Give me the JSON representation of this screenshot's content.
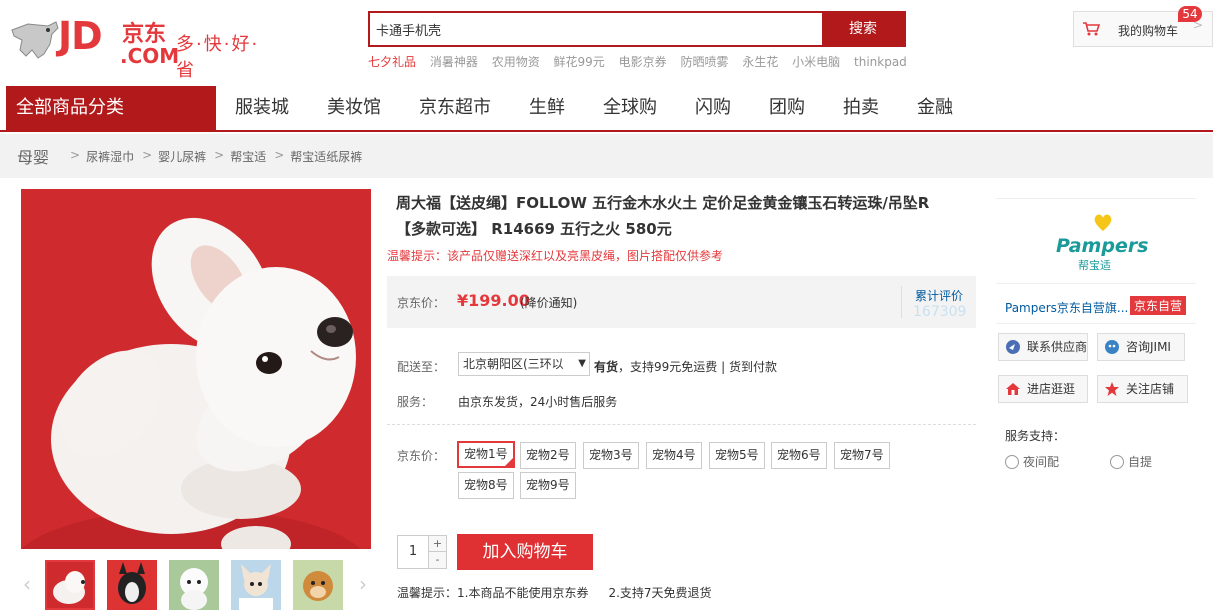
{
  "header": {
    "logo_text": "JD",
    "logo_cn": "京东",
    "logo_com": ".COM",
    "slogan": "多·快·好·省",
    "search": {
      "value": "卡通手机壳",
      "button": "搜索"
    },
    "hotwords": [
      "七夕礼品",
      "消暑神器",
      "农用物资",
      "鲜花99元",
      "电影京券",
      "防晒喷雾",
      "永生花",
      "小米电脑",
      "thinkpad"
    ],
    "cart": {
      "label": "我的购物车",
      "count": "54"
    }
  },
  "nav": {
    "all_categories": "全部商品分类",
    "items": [
      "服装城",
      "美妆馆",
      "京东超市",
      "生鲜",
      "全球购",
      "闪购",
      "团购",
      "拍卖",
      "金融"
    ]
  },
  "breadcrumb": {
    "root": "母婴",
    "items": [
      "尿裤湿巾",
      "婴儿尿裤",
      "帮宝适",
      "帮宝适纸尿裤"
    ]
  },
  "product": {
    "title": "周大福【送皮绳】FOLLOW 五行金木水火土 定价足金黄金镶玉石转运珠/吊坠R【多款可选】 R14669 五行之火 580元",
    "tip": "温馨提示：该产品仅赠送深红以及亮黑皮绳，图片搭配仅供参考",
    "price_label": "京东价：",
    "price": "¥199.00",
    "price_notice": "(降价通知)",
    "review_label": "累计评价",
    "review_count": "167309",
    "delivery_label": "配送至：",
    "address": "北京朝阳区(三环以",
    "stock_bold": "有货",
    "stock_text": "，支持99元免运费 | 货到付款",
    "service_label": "服务：",
    "service_text": "由京东发货，24小时售后服务",
    "options_label": "京东价：",
    "options": [
      "宠物1号",
      "宠物2号",
      "宠物3号",
      "宠物4号",
      "宠物5号",
      "宠物6号",
      "宠物7号",
      "宠物8号",
      "宠物9号"
    ],
    "selected_option": "宠物1号",
    "quantity": "1",
    "add_to_cart": "加入购物车",
    "warm_tip_label": "温馨提示：",
    "warm_tips": [
      "1.本商品不能使用京东券",
      "2.支持7天免费退货"
    ]
  },
  "shop": {
    "brand": "Pampers",
    "brand_cn": "帮宝适",
    "name": "Pampers京东自营旗...",
    "self_badge": "京东自营",
    "buttons": [
      "联系供应商",
      "咨询JIMI",
      "进店逛逛",
      "关注店铺"
    ],
    "service_label": "服务支持：",
    "services": [
      "夜间配",
      "自提"
    ]
  },
  "colors": {
    "accent": "#e4393c",
    "nav_dark": "#b1191a",
    "link": "#005aa0"
  }
}
